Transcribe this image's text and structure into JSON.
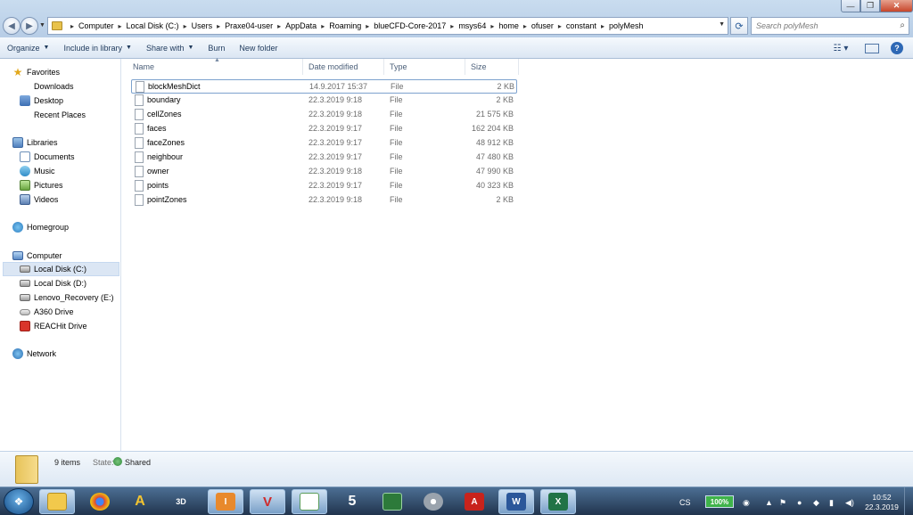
{
  "window": {
    "controls": {
      "minimize": "—",
      "maximize": "❐",
      "close": "✕"
    }
  },
  "address_bar": {
    "crumbs": [
      "Computer",
      "Local Disk (C:)",
      "Users",
      "Praxe04-user",
      "AppData",
      "Roaming",
      "blueCFD-Core-2017",
      "msys64",
      "home",
      "ofuser",
      "constant",
      "polyMesh"
    ],
    "separator": "▸"
  },
  "search": {
    "placeholder": "Search polyMesh"
  },
  "toolbar": {
    "organize": "Organize",
    "include_in_library": "Include in library",
    "share_with": "Share with",
    "burn": "Burn",
    "new_folder": "New folder"
  },
  "sidebar": {
    "favorites": {
      "label": "Favorites",
      "items": [
        "Downloads",
        "Desktop",
        "Recent Places"
      ]
    },
    "libraries": {
      "label": "Libraries",
      "items": [
        "Documents",
        "Music",
        "Pictures",
        "Videos"
      ]
    },
    "homegroup": "Homegroup",
    "computer": {
      "label": "Computer",
      "items": [
        "Local Disk (C:)",
        "Local Disk (D:)",
        "Lenovo_Recovery (E:)",
        "A360 Drive",
        "REACHit Drive"
      ]
    },
    "network": "Network"
  },
  "columns": {
    "name": "Name",
    "date": "Date modified",
    "type": "Type",
    "size": "Size"
  },
  "files": [
    {
      "name": "blockMeshDict",
      "date": "14.9.2017 15:37",
      "type": "File",
      "size": "2 KB"
    },
    {
      "name": "boundary",
      "date": "22.3.2019 9:18",
      "type": "File",
      "size": "2 KB"
    },
    {
      "name": "cellZones",
      "date": "22.3.2019 9:18",
      "type": "File",
      "size": "21 575 KB"
    },
    {
      "name": "faces",
      "date": "22.3.2019 9:17",
      "type": "File",
      "size": "162 204 KB"
    },
    {
      "name": "faceZones",
      "date": "22.3.2019 9:17",
      "type": "File",
      "size": "48 912 KB"
    },
    {
      "name": "neighbour",
      "date": "22.3.2019 9:17",
      "type": "File",
      "size": "47 480 KB"
    },
    {
      "name": "owner",
      "date": "22.3.2019 9:18",
      "type": "File",
      "size": "47 990 KB"
    },
    {
      "name": "points",
      "date": "22.3.2019 9:17",
      "type": "File",
      "size": "40 323 KB"
    },
    {
      "name": "pointZones",
      "date": "22.3.2019 9:18",
      "type": "File",
      "size": "2 KB"
    }
  ],
  "status": {
    "count": "9 items",
    "state_label": "State:",
    "state_value": "Shared"
  },
  "taskbar": {
    "apps": [
      {
        "name": "explorer",
        "glyph": "",
        "color": "#f2c94c"
      },
      {
        "name": "chrome",
        "glyph": "●",
        "color": "#db4437"
      },
      {
        "name": "app-a",
        "glyph": "A",
        "color": "#f4c430"
      },
      {
        "name": "app-3ds",
        "glyph": "3D",
        "color": "#444444"
      },
      {
        "name": "app-inventor",
        "glyph": "I",
        "color": "#e8892c"
      },
      {
        "name": "app-v",
        "glyph": "V",
        "color": "#d02a2a"
      },
      {
        "name": "app-window",
        "glyph": "▭",
        "color": "#5a9c5a"
      },
      {
        "name": "app-x5",
        "glyph": "5",
        "color": "#333333"
      },
      {
        "name": "app-monitor",
        "glyph": "▬",
        "color": "#2d7a3a"
      },
      {
        "name": "app-disc",
        "glyph": "◎",
        "color": "#9aa3ad"
      },
      {
        "name": "acrobat",
        "glyph": "A",
        "color": "#c8231c"
      },
      {
        "name": "word",
        "glyph": "W",
        "color": "#2b579a"
      },
      {
        "name": "excel",
        "glyph": "X",
        "color": "#217346"
      }
    ],
    "language": "CS",
    "battery": "100%",
    "time": "10:52",
    "date": "22.3.2019"
  }
}
